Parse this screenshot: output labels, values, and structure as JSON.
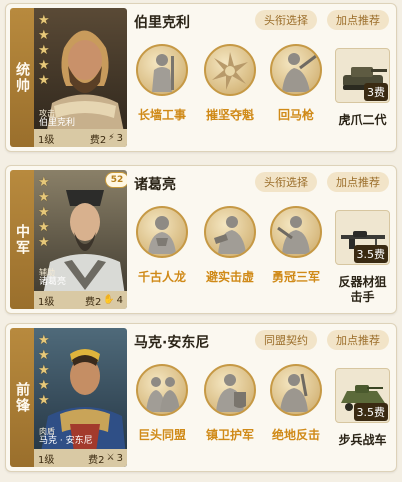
{
  "cards": [
    {
      "role": "统帅",
      "name": "伯里克利",
      "portrait_sub": "攻击",
      "portrait_name": "伯里克利",
      "level": "1级",
      "cost": "费2",
      "extra": "3",
      "extra_icon": "bolt-icon",
      "badge": "",
      "btn1": "头衔选择",
      "btn2": "加点推荐",
      "skills": [
        "长墙工事",
        "摧坚夺魁",
        "回马枪"
      ],
      "equip_name": "虎爪二代",
      "equip_cost": "3费"
    },
    {
      "role": "中军",
      "name": "诸葛亮",
      "portrait_sub": "辅助",
      "portrait_name": "诸葛亮",
      "level": "1级",
      "cost": "费2",
      "extra": "4",
      "extra_icon": "hand-icon",
      "badge": "52",
      "btn1": "头衔选择",
      "btn2": "加点推荐",
      "skills": [
        "千古人龙",
        "避实击虚",
        "勇冠三军"
      ],
      "equip_name": "反器材狙击手",
      "equip_cost": "3.5费"
    },
    {
      "role": "前锋",
      "name": "马克·安东尼",
      "portrait_sub": "肉盾",
      "portrait_name": "马克 · 安东尼",
      "level": "1级",
      "cost": "费2",
      "extra": "3",
      "extra_icon": "sword-icon",
      "badge": "",
      "btn1": "同盟契约",
      "btn2": "加点推荐",
      "skills": [
        "巨头同盟",
        "镇卫护军",
        "绝地反击"
      ],
      "equip_name": "步兵战车",
      "equip_cost": "3.5费"
    }
  ],
  "colors": {
    "role_strip": "#b88a3e",
    "skill_label": "#d08a18",
    "pill_bg": "#f2e4c8",
    "pill_text": "#9b6e2a"
  }
}
